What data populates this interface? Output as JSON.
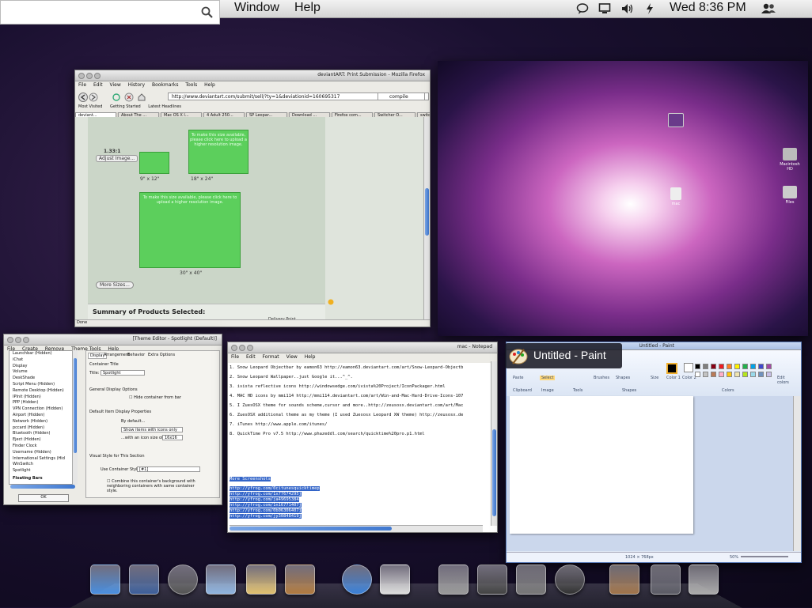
{
  "menubar": {
    "items": [
      "Window",
      "Help"
    ],
    "clock": "Wed 8:36 PM",
    "search_placeholder": ""
  },
  "firefox": {
    "title": "deviantART: Print Submission - Mozilla Firefox",
    "menu": [
      "File",
      "Edit",
      "View",
      "History",
      "Bookmarks",
      "Tools",
      "Help"
    ],
    "url": "http://www.deviantart.com/submit/sell/?ty=1&deviationid=160695317",
    "search_value": "compile",
    "bookmarks": [
      "Most Visited",
      "Getting Started",
      "Latest Headlines"
    ],
    "tabs": [
      "deviant...",
      "About The ...",
      "Mac OS X l...",
      "4 Adult 250...",
      "SP Leopar...",
      "Download ...",
      "Firefox com...",
      "Switcher O...",
      "switcher 2 ..."
    ],
    "ratio": "1.33:1",
    "adjust_image": "Adjust Image...",
    "upload_msg": "To make this size available, please click here to upload a higher resolution image.",
    "sizes": [
      "9\" x 12\"",
      "18\" x 24\"",
      "30\" x 40\""
    ],
    "more_sizes": "More Sizes...",
    "summary": "Summary of Products Selected:",
    "delivery": "Delivery Point",
    "status": "Done"
  },
  "wallpaper": {
    "icons": [
      "Macintosh HD",
      "Files",
      "mac"
    ]
  },
  "theme_editor": {
    "title": "[Theme Editor - Spotlight (Default)]",
    "menu": [
      "File",
      "Create",
      "Remove",
      "Theme Tools",
      "Help"
    ],
    "tree": [
      "Launchbar (Hidden)",
      "iChat",
      "Display",
      "Volume",
      "DeskShade",
      "Script Menu (Hidden)",
      "Remote Desktop (Hidden)",
      "IPInit (Hidden)",
      "PPP (Hidden)",
      "VPN Connection (Hidden)",
      "Airport (Hidden)",
      "Network (Hidden)",
      "pccard (Hidden)",
      "Bluetooth (Hidden)",
      "Eject (Hidden)",
      "Finder Clock",
      "Username (Hidden)",
      "International Settings (Hid",
      "WinSwitch",
      "Spotlight"
    ],
    "floating_bars": "Floating Bars",
    "tabs": [
      "Display",
      "Arrangement",
      "Behavior",
      "Extra Options"
    ],
    "container_title": "Container Title",
    "title_label": "Title:",
    "title_value": "Spotlight",
    "general_display": "General Display Options",
    "hide_container": "Hide container from bar",
    "default_item": "Default Item Display Properties",
    "by_default": "By default...",
    "show_items": "Show items with icons only",
    "icon_size_label": "...with an icon size of:",
    "icon_size": "16x16",
    "visual_style": "Visual Style for This Section",
    "use_container": "Use Container Style:",
    "container_style": "[#1]",
    "combine": "Combine this container's background with neighboring containers with same container style.",
    "ok": "OK"
  },
  "notepad": {
    "title": "mac - Notepad",
    "menu": [
      "File",
      "Edit",
      "Format",
      "View",
      "Help"
    ],
    "lines": [
      "1. Snow Leopard Objectbar by eamon63 http://eamon63.deviantart.com/art/Snow-Leopard-Objectb",
      "2. Snow Leopard Wallpaper..just Google it...^_^.",
      "3. ivista reflective icons http://windowsedge.com/ivista%20Project/IconPackager.html",
      "4. MAC HD icons by mmi114 http://mmi114.deviantart.com/art/Win-and-Mac-Hard-Drive-Icons-107",
      "5. I ZuesOSX theme for sounds scheme,cursor and more..http://zeusosx.deviantart.com/art/Mac",
      "6. ZuesOSX additional theme as my theme (I used Zuesosx Leopard XW theme) http://zeusosx.de",
      "7. iTunes http://www.apple.com/itunes/",
      "8. QuickTime Pro v7.5 http://www.phazeddl.com/search/quicktime%20pro.p1.html"
    ],
    "selected": [
      "More Screenshots",
      "http://yfrog.com/0citunesquicktimep",
      "http://yfrog.com/1x77674295j",
      "http://yfrog.com/ja49695384",
      "http://yfrog.com/1n16771407j",
      "http://yfrog.com/0b06306407j",
      "http://yfrog.com/jy30848419j"
    ]
  },
  "paint": {
    "window_title": "Untitled - Paint",
    "switcher_title": "Untitled - Paint",
    "ribbon_labels": [
      "Paste",
      "Select",
      "Brushes",
      "Shapes",
      "Size",
      "Color 1",
      "Color 2",
      "Edit colors"
    ],
    "groups": [
      "Clipboard",
      "Image",
      "Tools",
      "Shapes",
      "Colors"
    ],
    "status_size": "1024 × 768px",
    "zoom": "50%"
  },
  "colors": {
    "selection": "#3264c8",
    "palette": [
      "#000000",
      "#7f7f7f",
      "#880015",
      "#ed1c24",
      "#ff7f27",
      "#fff200",
      "#22b14c",
      "#00a2e8",
      "#3f48cc",
      "#a349a4",
      "#ffffff",
      "#c3c3c3",
      "#b97a57",
      "#ffaec9",
      "#ffc90e",
      "#efe4b0",
      "#b5e61d",
      "#99d9ea",
      "#7092be",
      "#c8bfe7"
    ]
  },
  "dock": {
    "icons": [
      "finder-icon",
      "mission-control-icon",
      "dashboard-icon",
      "app-store-icon",
      "mail-icon",
      "address-book-icon",
      "safari-icon",
      "textedit-icon",
      "utilities-icon",
      "calculator-icon",
      "system-preferences-icon",
      "shutdown-icon",
      "iphoto-icon",
      "downloads-stack-icon",
      "trash-icon"
    ]
  }
}
